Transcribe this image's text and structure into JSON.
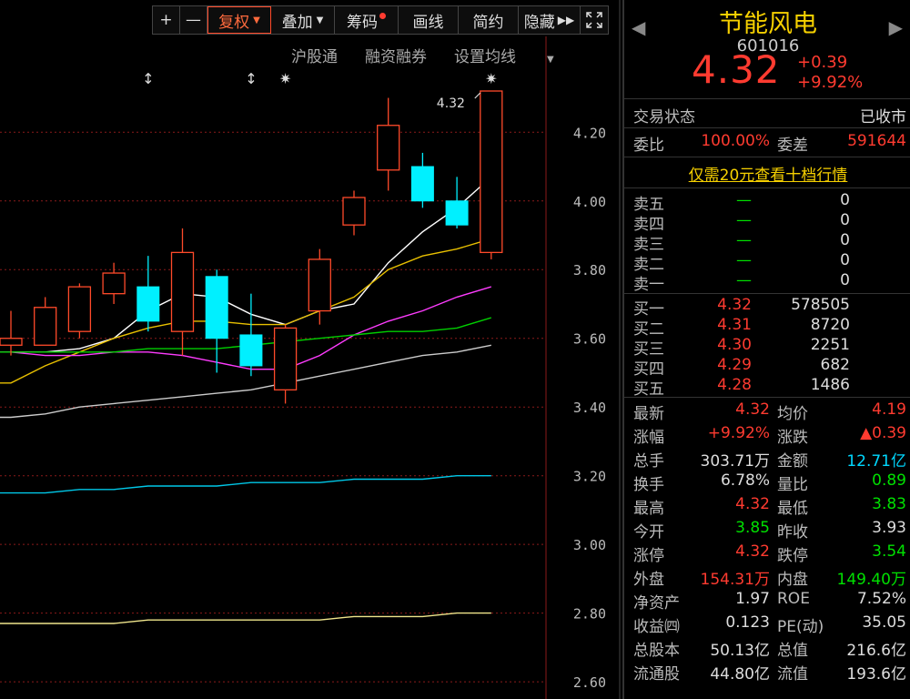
{
  "toolbar": {
    "plus": "+",
    "minus": "—",
    "fuquan": "复权",
    "diejia": "叠加",
    "chouma": "筹码",
    "huaxian": "画线",
    "jianyue": "简约",
    "yincang": "隐藏",
    "expand_icon": "expand-icon"
  },
  "sub_toolbar": {
    "hugutong": "沪股通",
    "rongzi": "融资融券",
    "set_ma": "设置均线"
  },
  "chart_data": {
    "type": "candlestick",
    "ylim": [
      2.55,
      4.32
    ],
    "y_ticks": [
      "4.20",
      "4.00",
      "3.80",
      "3.60",
      "3.40",
      "3.20",
      "3.00",
      "2.80",
      "2.60"
    ],
    "high_label": "4.32",
    "candles": [
      {
        "open": 3.58,
        "close": 3.6,
        "high": 3.68,
        "low": 3.55,
        "dir": "up"
      },
      {
        "open": 3.58,
        "close": 3.69,
        "high": 3.72,
        "low": 3.58,
        "dir": "up"
      },
      {
        "open": 3.62,
        "close": 3.75,
        "high": 3.76,
        "low": 3.6,
        "dir": "up"
      },
      {
        "open": 3.73,
        "close": 3.79,
        "high": 3.82,
        "low": 3.7,
        "dir": "up"
      },
      {
        "open": 3.75,
        "close": 3.65,
        "high": 3.84,
        "low": 3.62,
        "dir": "down"
      },
      {
        "open": 3.62,
        "close": 3.85,
        "high": 3.92,
        "low": 3.55,
        "dir": "up"
      },
      {
        "open": 3.78,
        "close": 3.6,
        "high": 3.8,
        "low": 3.5,
        "dir": "down"
      },
      {
        "open": 3.61,
        "close": 3.52,
        "high": 3.73,
        "low": 3.49,
        "dir": "down"
      },
      {
        "open": 3.45,
        "close": 3.63,
        "high": 3.64,
        "low": 3.41,
        "dir": "up"
      },
      {
        "open": 3.68,
        "close": 3.83,
        "high": 3.86,
        "low": 3.64,
        "dir": "up"
      },
      {
        "open": 3.93,
        "close": 4.01,
        "high": 4.03,
        "low": 3.9,
        "dir": "up"
      },
      {
        "open": 4.09,
        "close": 4.22,
        "high": 4.3,
        "low": 4.03,
        "dir": "up"
      },
      {
        "open": 4.1,
        "close": 4.0,
        "high": 4.14,
        "low": 3.98,
        "dir": "down"
      },
      {
        "open": 4.0,
        "close": 3.93,
        "high": 4.07,
        "low": 3.92,
        "dir": "down"
      },
      {
        "open": 3.85,
        "close": 4.32,
        "high": 4.32,
        "low": 3.83,
        "dir": "up"
      }
    ],
    "ma_lines": [
      {
        "color": "#ffffff",
        "values": [
          3.56,
          3.56,
          3.57,
          3.6,
          3.68,
          3.73,
          3.72,
          3.67,
          3.64,
          3.68,
          3.7,
          3.82,
          3.91,
          3.98,
          4.07
        ]
      },
      {
        "color": "#e8c000",
        "values": [
          3.47,
          3.52,
          3.56,
          3.6,
          3.63,
          3.65,
          3.65,
          3.64,
          3.64,
          3.68,
          3.72,
          3.8,
          3.84,
          3.86,
          3.89
        ]
      },
      {
        "color": "#ff3cff",
        "values": [
          3.56,
          3.55,
          3.55,
          3.56,
          3.56,
          3.55,
          3.53,
          3.51,
          3.51,
          3.55,
          3.61,
          3.65,
          3.68,
          3.72,
          3.75
        ]
      },
      {
        "color": "#00d000",
        "values": [
          3.56,
          3.56,
          3.56,
          3.56,
          3.57,
          3.57,
          3.57,
          3.58,
          3.59,
          3.6,
          3.61,
          3.62,
          3.62,
          3.63,
          3.66
        ]
      },
      {
        "color": "#cccccc",
        "values": [
          3.37,
          3.38,
          3.4,
          3.41,
          3.42,
          3.43,
          3.44,
          3.45,
          3.47,
          3.49,
          3.51,
          3.53,
          3.55,
          3.56,
          3.58
        ]
      },
      {
        "color": "#00c8e8",
        "values": [
          3.15,
          3.15,
          3.16,
          3.16,
          3.17,
          3.17,
          3.17,
          3.18,
          3.18,
          3.18,
          3.19,
          3.19,
          3.19,
          3.2,
          3.2
        ]
      },
      {
        "color": "#f0e68c",
        "values": [
          2.77,
          2.77,
          2.77,
          2.77,
          2.78,
          2.78,
          2.78,
          2.78,
          2.78,
          2.78,
          2.79,
          2.79,
          2.79,
          2.8,
          2.8
        ]
      }
    ],
    "markers": [
      {
        "index": 4,
        "symbol": "↕"
      },
      {
        "index": 7,
        "symbol": "↕"
      },
      {
        "index": 8,
        "symbol": "✷"
      },
      {
        "index": 14,
        "symbol": "✷"
      }
    ]
  },
  "panel": {
    "name": "节能风电",
    "code": "601016",
    "price": "4.32",
    "change": "+0.39",
    "change_pct": "+9.92%",
    "status_label": "交易状态",
    "status_value": "已收市",
    "webi_label": "委比",
    "webi_value": "100.00%",
    "weicha_label": "委差",
    "weicha_value": "591644",
    "promo": "仅需20元查看十档行情",
    "asks": [
      {
        "label": "卖五",
        "price": "—",
        "vol": "0"
      },
      {
        "label": "卖四",
        "price": "—",
        "vol": "0"
      },
      {
        "label": "卖三",
        "price": "—",
        "vol": "0"
      },
      {
        "label": "卖二",
        "price": "—",
        "vol": "0"
      },
      {
        "label": "卖一",
        "price": "—",
        "vol": "0"
      }
    ],
    "bids": [
      {
        "label": "买一",
        "price": "4.32",
        "vol": "578505"
      },
      {
        "label": "买二",
        "price": "4.31",
        "vol": "8720"
      },
      {
        "label": "买三",
        "price": "4.30",
        "vol": "2251"
      },
      {
        "label": "买四",
        "price": "4.29",
        "vol": "682"
      },
      {
        "label": "买五",
        "price": "4.28",
        "vol": "1486"
      }
    ],
    "quotes": [
      {
        "l1": "最新",
        "v1": "4.32",
        "c1": "red",
        "l2": "均价",
        "v2": "4.19",
        "c2": "red"
      },
      {
        "l1": "涨幅",
        "v1": "+9.92%",
        "c1": "red",
        "l2": "涨跌",
        "v2": "▲0.39",
        "c2": "red"
      },
      {
        "l1": "总手",
        "v1": "303.71万",
        "c1": "white",
        "l2": "金额",
        "v2": "12.71亿",
        "c2": "cyan"
      },
      {
        "l1": "换手",
        "v1": "6.78%",
        "c1": "white",
        "l2": "量比",
        "v2": "0.89",
        "c2": "green"
      },
      {
        "l1": "最高",
        "v1": "4.32",
        "c1": "red",
        "l2": "最低",
        "v2": "3.83",
        "c2": "green"
      },
      {
        "l1": "今开",
        "v1": "3.85",
        "c1": "green",
        "l2": "昨收",
        "v2": "3.93",
        "c2": "white"
      },
      {
        "l1": "涨停",
        "v1": "4.32",
        "c1": "red",
        "l2": "跌停",
        "v2": "3.54",
        "c2": "green"
      },
      {
        "l1": "外盘",
        "v1": "154.31万",
        "c1": "red",
        "l2": "内盘",
        "v2": "149.40万",
        "c2": "green"
      },
      {
        "l1": "净资产",
        "v1": "1.97",
        "c1": "white",
        "l2": "ROE",
        "v2": "7.52%",
        "c2": "white"
      },
      {
        "l1": "收益㈣",
        "v1": "0.123",
        "c1": "white",
        "l2": "PE(动)",
        "v2": "35.05",
        "c2": "white"
      },
      {
        "l1": "总股本",
        "v1": "50.13亿",
        "c1": "white",
        "l2": "总值",
        "v2": "216.6亿",
        "c2": "white"
      },
      {
        "l1": "流通股",
        "v1": "44.80亿",
        "c1": "white",
        "l2": "流值",
        "v2": "193.6亿",
        "c2": "white"
      }
    ]
  },
  "colors": {
    "up": "#ff4a2a",
    "down": "#00f0ff",
    "grid": "#8b1a1a",
    "axis_text": "#bbbbbb"
  }
}
